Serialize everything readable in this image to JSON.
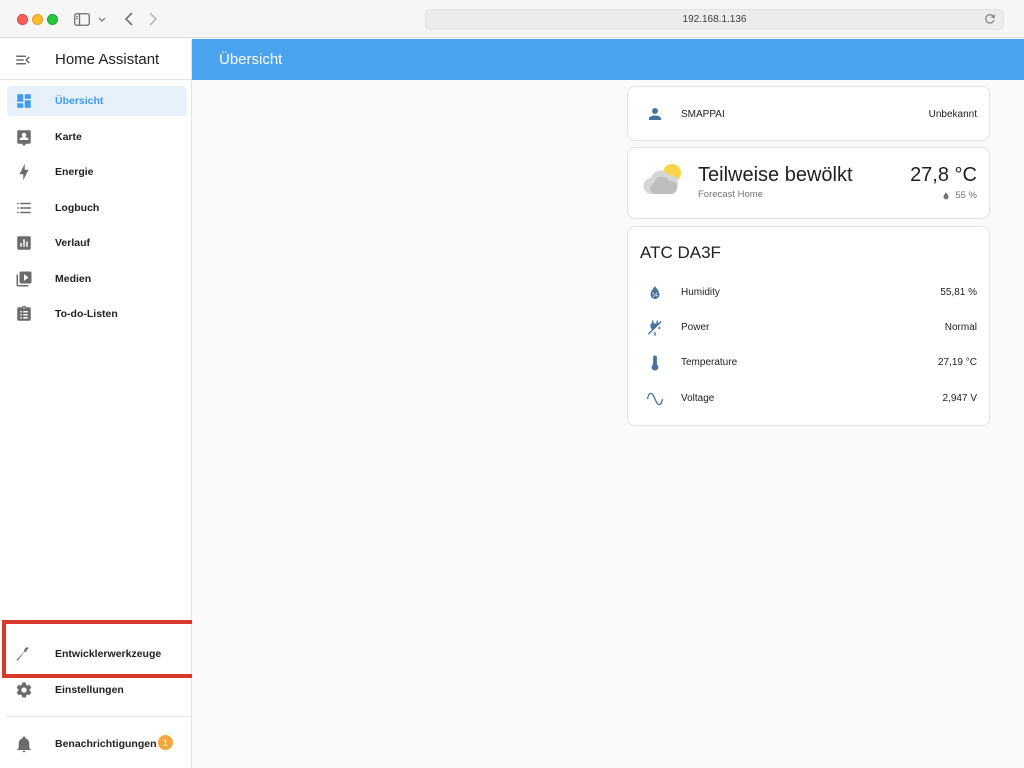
{
  "browser": {
    "url": "192.168.1.136"
  },
  "sidebar": {
    "title": "Home Assistant",
    "items": [
      {
        "label": "Übersicht",
        "icon": "dashboard-icon",
        "active": true
      },
      {
        "label": "Karte",
        "icon": "map-account-icon"
      },
      {
        "label": "Energie",
        "icon": "lightning-icon"
      },
      {
        "label": "Logbuch",
        "icon": "list-icon"
      },
      {
        "label": "Verlauf",
        "icon": "chart-box-icon"
      },
      {
        "label": "Medien",
        "icon": "play-box-icon"
      },
      {
        "label": "To-do-Listen",
        "icon": "clipboard-list-icon"
      }
    ],
    "bottom_items": [
      {
        "label": "Entwicklerwerkzeuge",
        "icon": "hammer-icon"
      },
      {
        "label": "Einstellungen",
        "icon": "cog-icon"
      }
    ],
    "notifications": {
      "label": "Benachrichtigungen",
      "count": "1"
    }
  },
  "header": {
    "title": "Übersicht"
  },
  "cards": {
    "person": {
      "name": "SMAPPAI",
      "state": "Unbekannt"
    },
    "weather": {
      "condition": "Teilweise bewölkt",
      "source": "Forecast Home",
      "temperature": "27,8 °C",
      "humidity": "55 %"
    },
    "sensor": {
      "title": "ATC DA3F",
      "entities": [
        {
          "name": "Humidity",
          "state": "55,81 %",
          "icon": "water-percent-icon"
        },
        {
          "name": "Power",
          "state": "Normal",
          "icon": "power-plug-off-icon"
        },
        {
          "name": "Temperature",
          "state": "27,19 °C",
          "icon": "thermometer-icon"
        },
        {
          "name": "Voltage",
          "state": "2,947 V",
          "icon": "sine-wave-icon"
        }
      ]
    }
  },
  "colors": {
    "primary": "#4aa3ef",
    "active_bg": "#e6f1fc",
    "entity_icon": "#44739e",
    "badge": "#f3a73a",
    "highlight": "#d8392b"
  }
}
